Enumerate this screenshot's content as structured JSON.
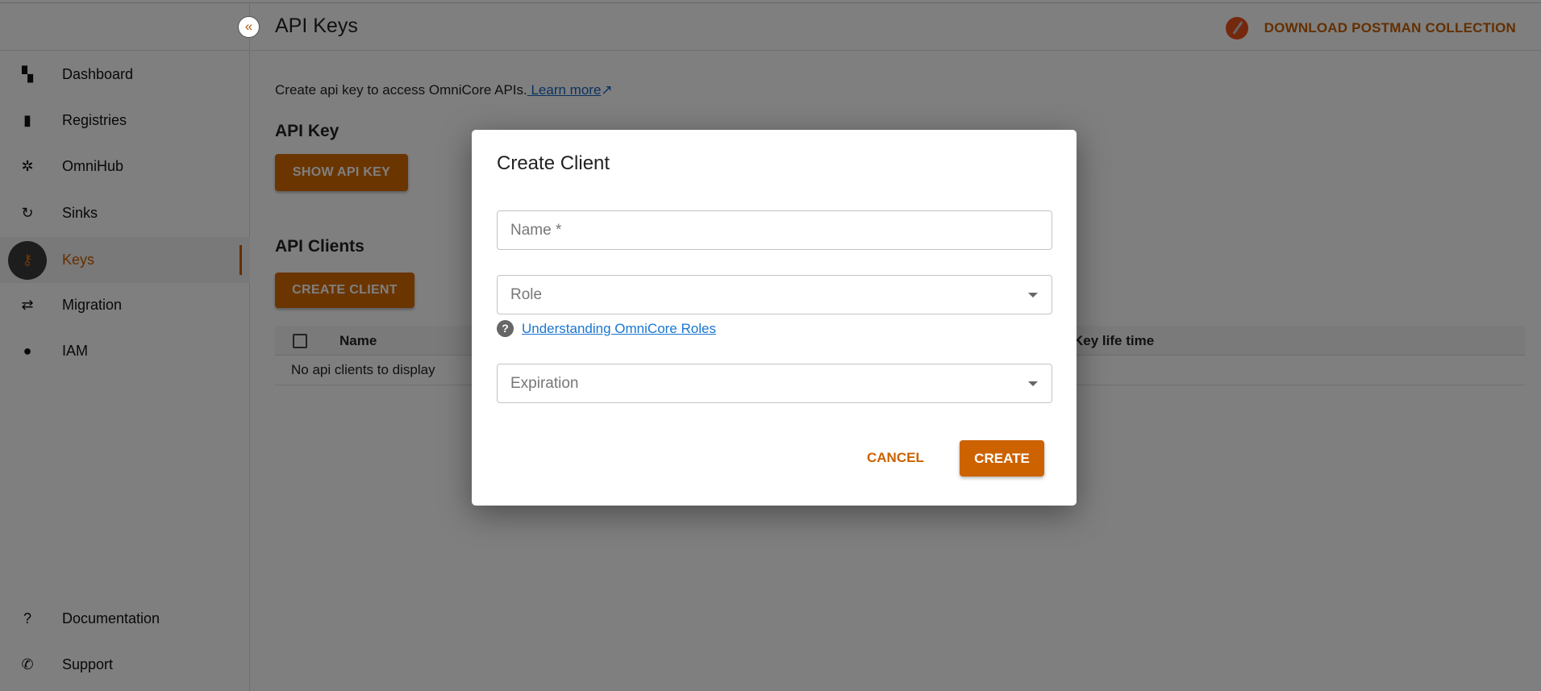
{
  "header": {
    "title": "API Keys",
    "download_label": "DOWNLOAD POSTMAN COLLECTION"
  },
  "sidebar": {
    "items": [
      {
        "label": "Dashboard",
        "icon": "dashboard-icon"
      },
      {
        "label": "Registries",
        "icon": "file-icon"
      },
      {
        "label": "OmniHub",
        "icon": "hub-icon"
      },
      {
        "label": "Sinks",
        "icon": "sync-icon"
      },
      {
        "label": "Keys",
        "icon": "key-icon",
        "active": true
      },
      {
        "label": "Migration",
        "icon": "swap-icon"
      },
      {
        "label": "IAM",
        "icon": "person-icon"
      }
    ],
    "bottom": [
      {
        "label": "Documentation",
        "icon": "help-icon"
      },
      {
        "label": "Support",
        "icon": "phone-icon"
      }
    ]
  },
  "main": {
    "description": "Create api key to access OmniCore APIs.",
    "learn_more": " Learn more",
    "api_key_heading": "API Key",
    "show_key_label": "SHOW API KEY",
    "clients_heading": "API Clients",
    "create_client_label": "CREATE CLIENT",
    "table": {
      "columns": [
        "Name",
        "Key life time"
      ],
      "empty": "No api clients to display"
    }
  },
  "dialog": {
    "title": "Create Client",
    "name_placeholder": "Name *",
    "role_placeholder": "Role",
    "help_link": "Understanding OmniCore Roles",
    "expiration_placeholder": "Expiration",
    "cancel_label": "CANCEL",
    "create_label": "CREATE"
  },
  "colors": {
    "accent": "#cc6200",
    "link": "#1976d2"
  }
}
